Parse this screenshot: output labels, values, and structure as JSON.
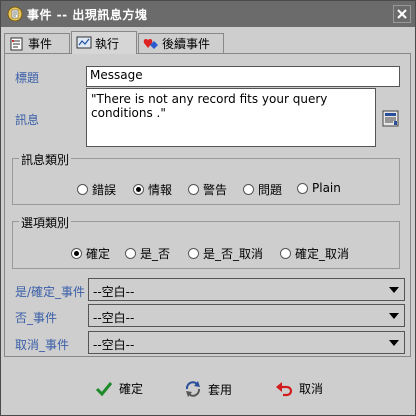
{
  "window": {
    "title": "事件 -- 出現訊息方塊",
    "app_icon": "event-app-icon",
    "close_icon": "close-icon"
  },
  "tabs": [
    {
      "label": "事件",
      "icon": "event-list-icon",
      "active": false
    },
    {
      "label": "執行",
      "icon": "chart-screen-icon",
      "active": true
    },
    {
      "label": "後續事件",
      "icon": "heart-diamond-icon",
      "active": false
    }
  ],
  "form": {
    "title_label": "標題",
    "title_value": "Message",
    "message_label": "訊息",
    "message_value": "\"There is not any record fits your query conditions .\"",
    "message_editor_icon": "text-editor-icon"
  },
  "message_type": {
    "group_label": "訊息類別",
    "options": [
      "錯誤",
      "情報",
      "警告",
      "問題",
      "Plain"
    ],
    "selected": "情報"
  },
  "option_type": {
    "group_label": "選項類別",
    "options": [
      "確定",
      "是_否",
      "是_否_取消",
      "確定_取消"
    ],
    "selected": "確定"
  },
  "events": [
    {
      "label": "是/確定_事件",
      "value": "--空白--"
    },
    {
      "label": "否_事件",
      "value": "--空白--"
    },
    {
      "label": "取消_事件",
      "value": "--空白--"
    }
  ],
  "buttons": {
    "ok": {
      "label": "確定",
      "icon": "checkmark-icon"
    },
    "apply": {
      "label": "套用",
      "icon": "apply-recycle-icon"
    },
    "cancel": {
      "label": "取消",
      "icon": "undo-arrow-icon"
    }
  },
  "colors": {
    "title_bar": "#6b6b6b",
    "label_blue": "#3a5fa8",
    "panel_bg": "#cecece"
  }
}
